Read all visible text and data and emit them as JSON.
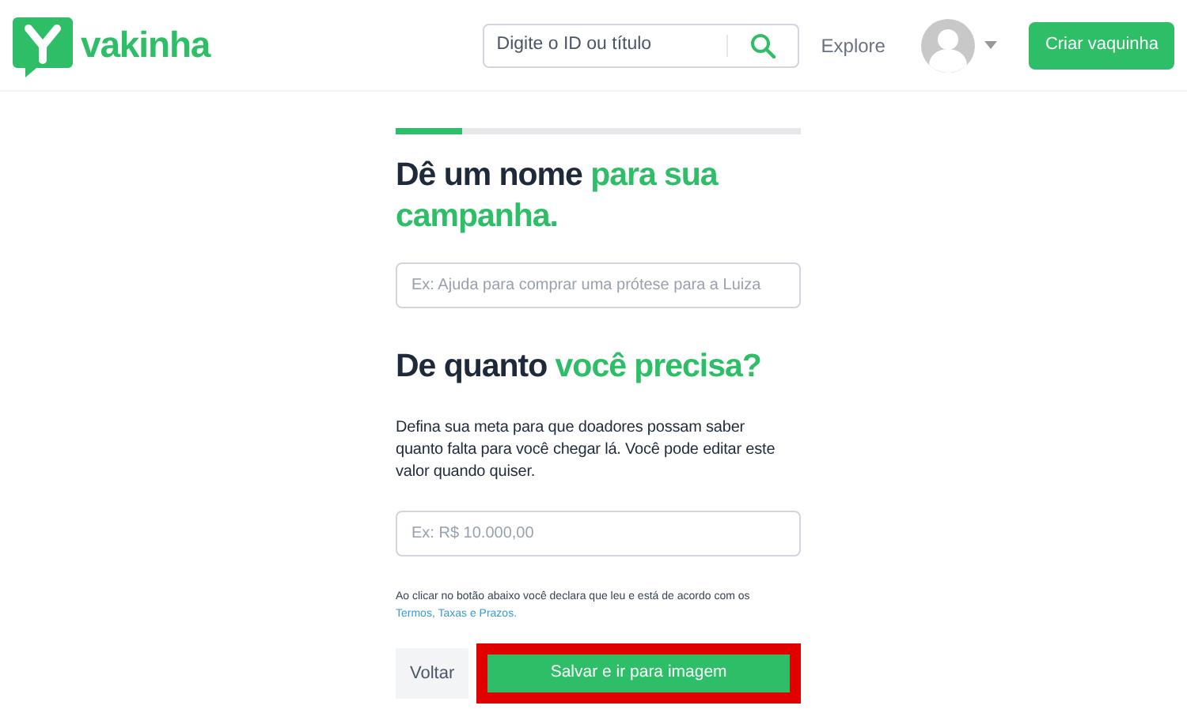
{
  "header": {
    "logo_text": "vakinha",
    "search": {
      "placeholder": "Digite o ID ou título"
    },
    "explore_link": "Explore",
    "create_button": "Criar vaquinha"
  },
  "progress": {
    "level": 0.165
  },
  "name_section": {
    "title": {
      "text": "Dê um nome",
      "highlight": "para sua campanha."
    },
    "input": {
      "placeholder": "Ex: Ajuda para comprar uma prótese para a Luiza"
    }
  },
  "goal_section": {
    "title": {
      "text": "De quanto",
      "highlight": "você precisa?"
    },
    "description": "Defina sua meta para que doadores possam saber quanto falta para você chegar lá. Você pode editar este valor quando quiser.",
    "input": {
      "placeholder": "Ex: R$ 10.000,00"
    }
  },
  "terms": {
    "text": "Ao clicar no botão abaixo você declara que leu e está de acordo com os",
    "link": "Termos, Taxas e Prazos."
  },
  "buttons": [
    {
      "kind": "secondary",
      "label": "Voltar",
      "highlighted": false
    },
    {
      "kind": "primary",
      "label": "Salvar e ir para imagem",
      "highlighted": true
    }
  ]
}
